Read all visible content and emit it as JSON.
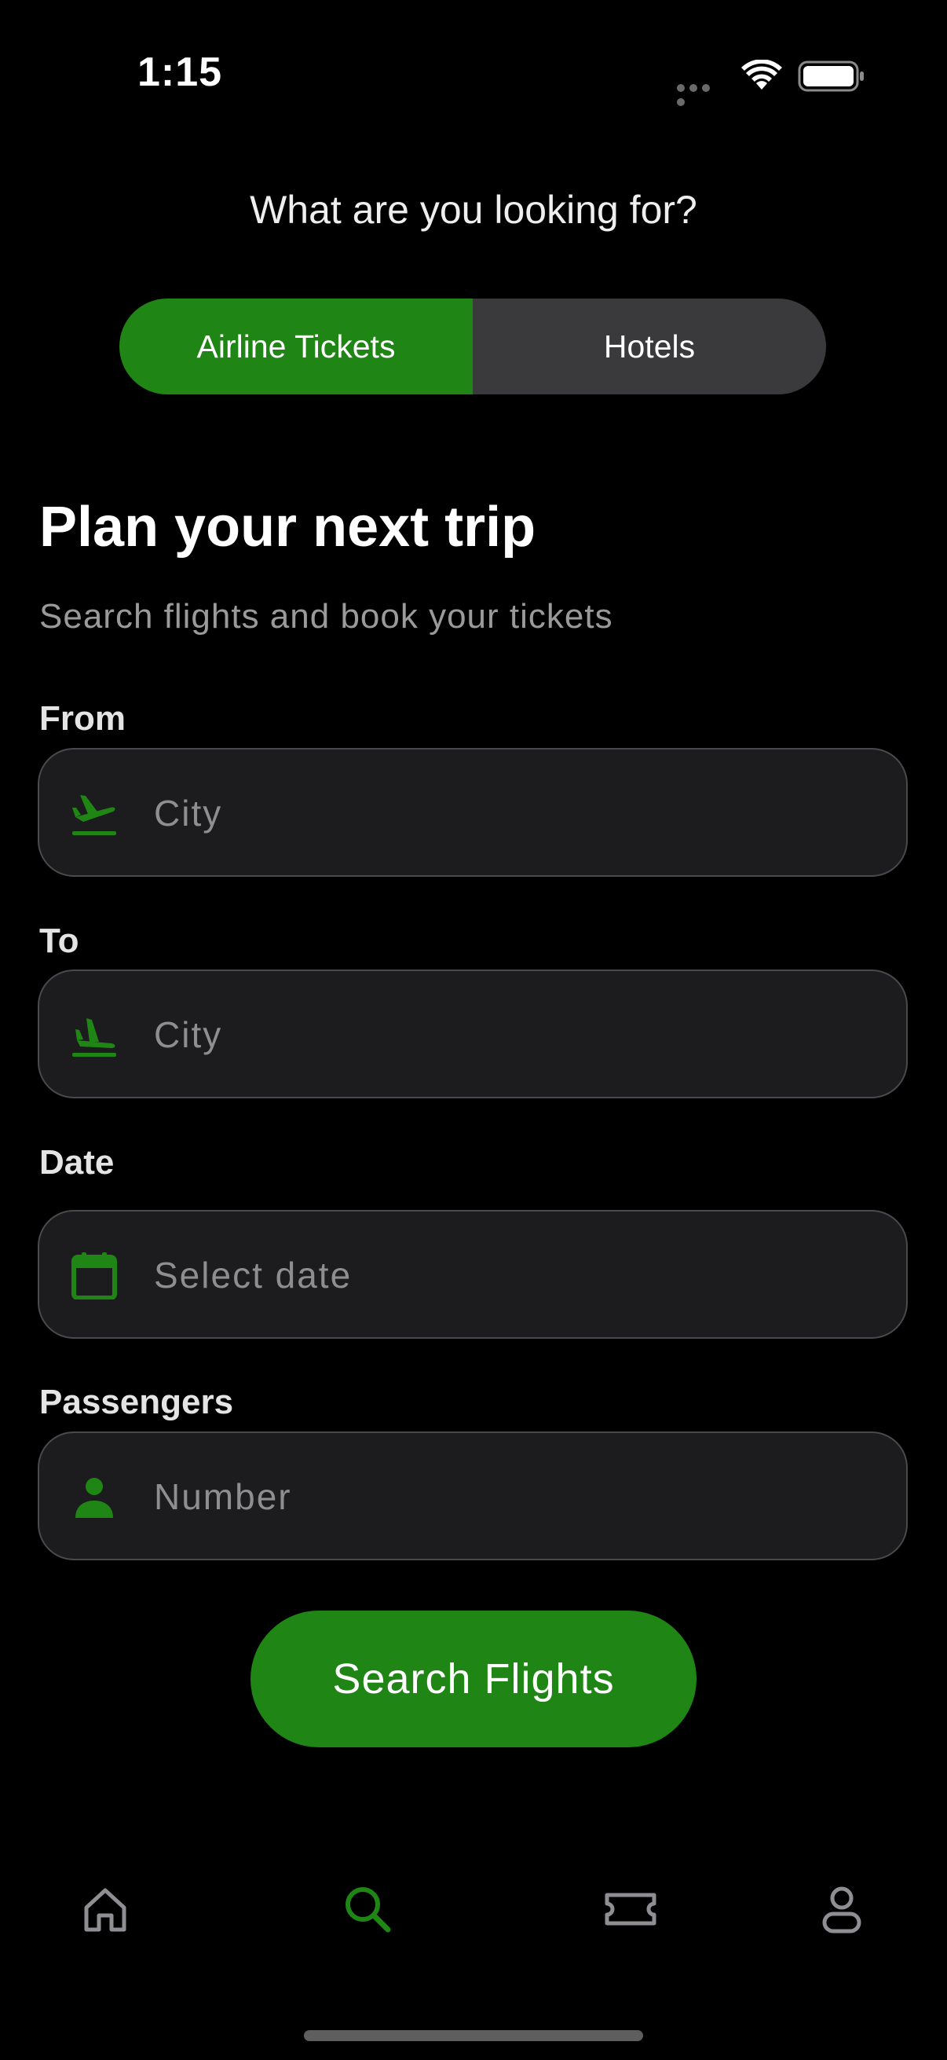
{
  "status_bar": {
    "time": "1:15",
    "icons": [
      "signal-dots-icon",
      "wifi-icon",
      "battery-icon"
    ]
  },
  "header": {
    "question": "What are you looking for?"
  },
  "segmented": {
    "options": [
      "Airline Tickets",
      "Hotels"
    ],
    "selected": "Airline Tickets"
  },
  "main": {
    "title": "Plan your next trip",
    "subtitle": "Search flights and book your tickets"
  },
  "form": {
    "from": {
      "label": "From",
      "placeholder": "City",
      "value": "",
      "icon": "plane-takeoff-icon"
    },
    "to": {
      "label": "To",
      "placeholder": "City",
      "value": "",
      "icon": "plane-landing-icon"
    },
    "date": {
      "label": "Date",
      "placeholder": "Select date",
      "value": "",
      "icon": "calendar-icon"
    },
    "passengers": {
      "label": "Passengers",
      "placeholder": "Number",
      "value": "",
      "icon": "person-icon"
    },
    "submit_label": "Search Flights"
  },
  "tab_bar": {
    "items": [
      {
        "name": "home",
        "icon": "home-icon",
        "active": false
      },
      {
        "name": "search",
        "icon": "search-icon",
        "active": true
      },
      {
        "name": "tickets",
        "icon": "ticket-icon",
        "active": false
      },
      {
        "name": "profile",
        "icon": "profile-icon",
        "active": false
      }
    ]
  },
  "colors": {
    "accent": "#1f8514",
    "background": "#000000",
    "field_bg": "#1c1c1e",
    "field_border": "#4a4a4c",
    "segment_inactive": "#3a3a3c",
    "inactive_icon": "#8e8e93"
  }
}
